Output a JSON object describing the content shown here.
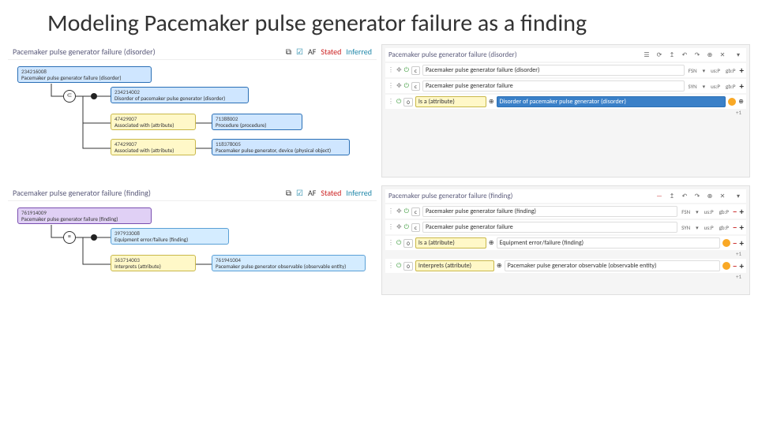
{
  "title": "Modeling Pacemaker pulse generator failure as a finding",
  "top": {
    "left": {
      "header": "Pacemaker pulse generator failure (disorder)",
      "toolbar": {
        "af": "AF",
        "stated": "Stated",
        "inferred": "Inferred"
      },
      "nodes": {
        "root": {
          "id": "234216008",
          "label": "Pacemaker pulse generator failure (disorder)"
        },
        "parent": {
          "id": "234214002",
          "label": "Disorder of pacemaker pulse generator (disorder)"
        },
        "attr1": {
          "id": "47429007",
          "label": "Associated with (attribute)"
        },
        "val1": {
          "id": "71388002",
          "label": "Procedure (procedure)"
        },
        "attr2": {
          "id": "47429007",
          "label": "Associated with (attribute)"
        },
        "val2": {
          "id": "118378005",
          "label": "Pacemaker pulse generator, device (physical object)"
        }
      },
      "rel": "⊂"
    },
    "right": {
      "header": "Pacemaker pulse generator failure (disorder)",
      "icons": [
        "⟳",
        "↥",
        "↶",
        "↷",
        "⊕",
        "✕"
      ],
      "rows": [
        {
          "c": "c",
          "text": "Pacemaker pulse generator failure (disorder)",
          "tags": [
            "FSN",
            "▾",
            "us:P",
            "gb:P"
          ],
          "plus": "+"
        },
        {
          "c": "c",
          "text": "Pacemaker pulse generator failure",
          "tags": [
            "SYN",
            "▾",
            "us:P",
            "gb:P"
          ],
          "plus": "+"
        }
      ],
      "group": {
        "g": "0",
        "attr": "Is a (attribute)",
        "val": "Disorder of pacemaker pulse generator (disorder)",
        "sub": "+1"
      }
    }
  },
  "bottom": {
    "left": {
      "header": "Pacemaker pulse generator failure (finding)",
      "toolbar": {
        "af": "AF",
        "stated": "Stated",
        "inferred": "Inferred"
      },
      "nodes": {
        "root": {
          "id": "761914009",
          "label": "Pacemaker pulse generator failure (finding)"
        },
        "parent": {
          "id": "397933008",
          "label": "Equipment error/failure (finding)"
        },
        "attr": {
          "id": "363714003",
          "label": "Interprets (attribute)"
        },
        "val": {
          "id": "761941004",
          "label": "Pacemaker pulse generator observable (observable entity)"
        }
      },
      "rel": "≡"
    },
    "right": {
      "header": "Pacemaker pulse generator failure (finding)",
      "icons": [
        "—",
        "↥",
        "↶",
        "↷",
        "⊕",
        "✕"
      ],
      "rows": [
        {
          "c": "c",
          "text": "Pacemaker pulse generator failure (finding)",
          "tags": [
            "FSN",
            "▾",
            "us:P",
            "gb:P"
          ],
          "pm": true
        },
        {
          "c": "c",
          "text": "Pacemaker pulse generator failure",
          "tags": [
            "SYN",
            "▾",
            "us:P",
            "gb:P"
          ],
          "pm": true
        }
      ],
      "groups": [
        {
          "g": "0",
          "attr": "Is a (attribute)",
          "val": "Equipment error/failure (finding)",
          "sub": "+1"
        },
        {
          "g": "0",
          "attr": "Interprets (attribute)",
          "val": "Pacemaker pulse generator observable (observable entity)",
          "sub": "+1"
        }
      ]
    }
  }
}
